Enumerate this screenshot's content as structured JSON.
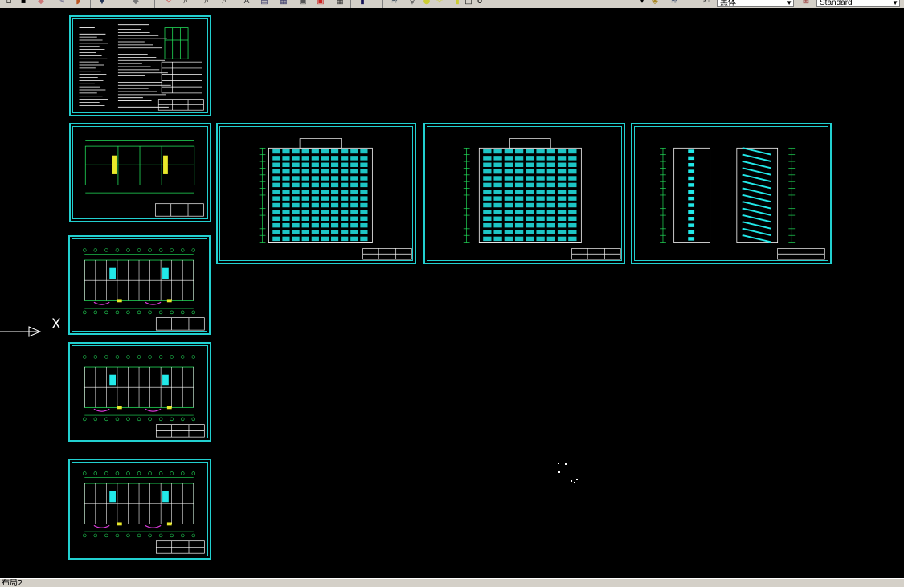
{
  "toolbar": {
    "layer_combo": "黑体",
    "style_combo": "Standard",
    "icons": [
      "zoom-realtime-icon",
      "zoom-window-icon",
      "zoom-previous-icon",
      "properties-icon",
      "design-center-icon",
      "tool-palettes-icon",
      "calculator-icon",
      "help-icon",
      "layer-manager-icon",
      "layer-state-icon",
      "text-style-icon"
    ]
  },
  "canvas": {
    "background": "#000000",
    "sheet_frame_color": "#22d0d0",
    "ucs_axis_label": "X"
  },
  "sheets": [
    {
      "id": "design-notes",
      "kind": "notes"
    },
    {
      "id": "first-floor-plan",
      "kind": "plan"
    },
    {
      "id": "front-elevation",
      "kind": "elevation"
    },
    {
      "id": "rear-elevation",
      "kind": "elevation"
    },
    {
      "id": "side-elevation-section",
      "kind": "section"
    },
    {
      "id": "standard-floor-plan",
      "kind": "plan"
    },
    {
      "id": "upper-floor-plan",
      "kind": "plan"
    },
    {
      "id": "roof-plan",
      "kind": "plan"
    }
  ],
  "layout_tabs": {
    "current": "布局2"
  }
}
